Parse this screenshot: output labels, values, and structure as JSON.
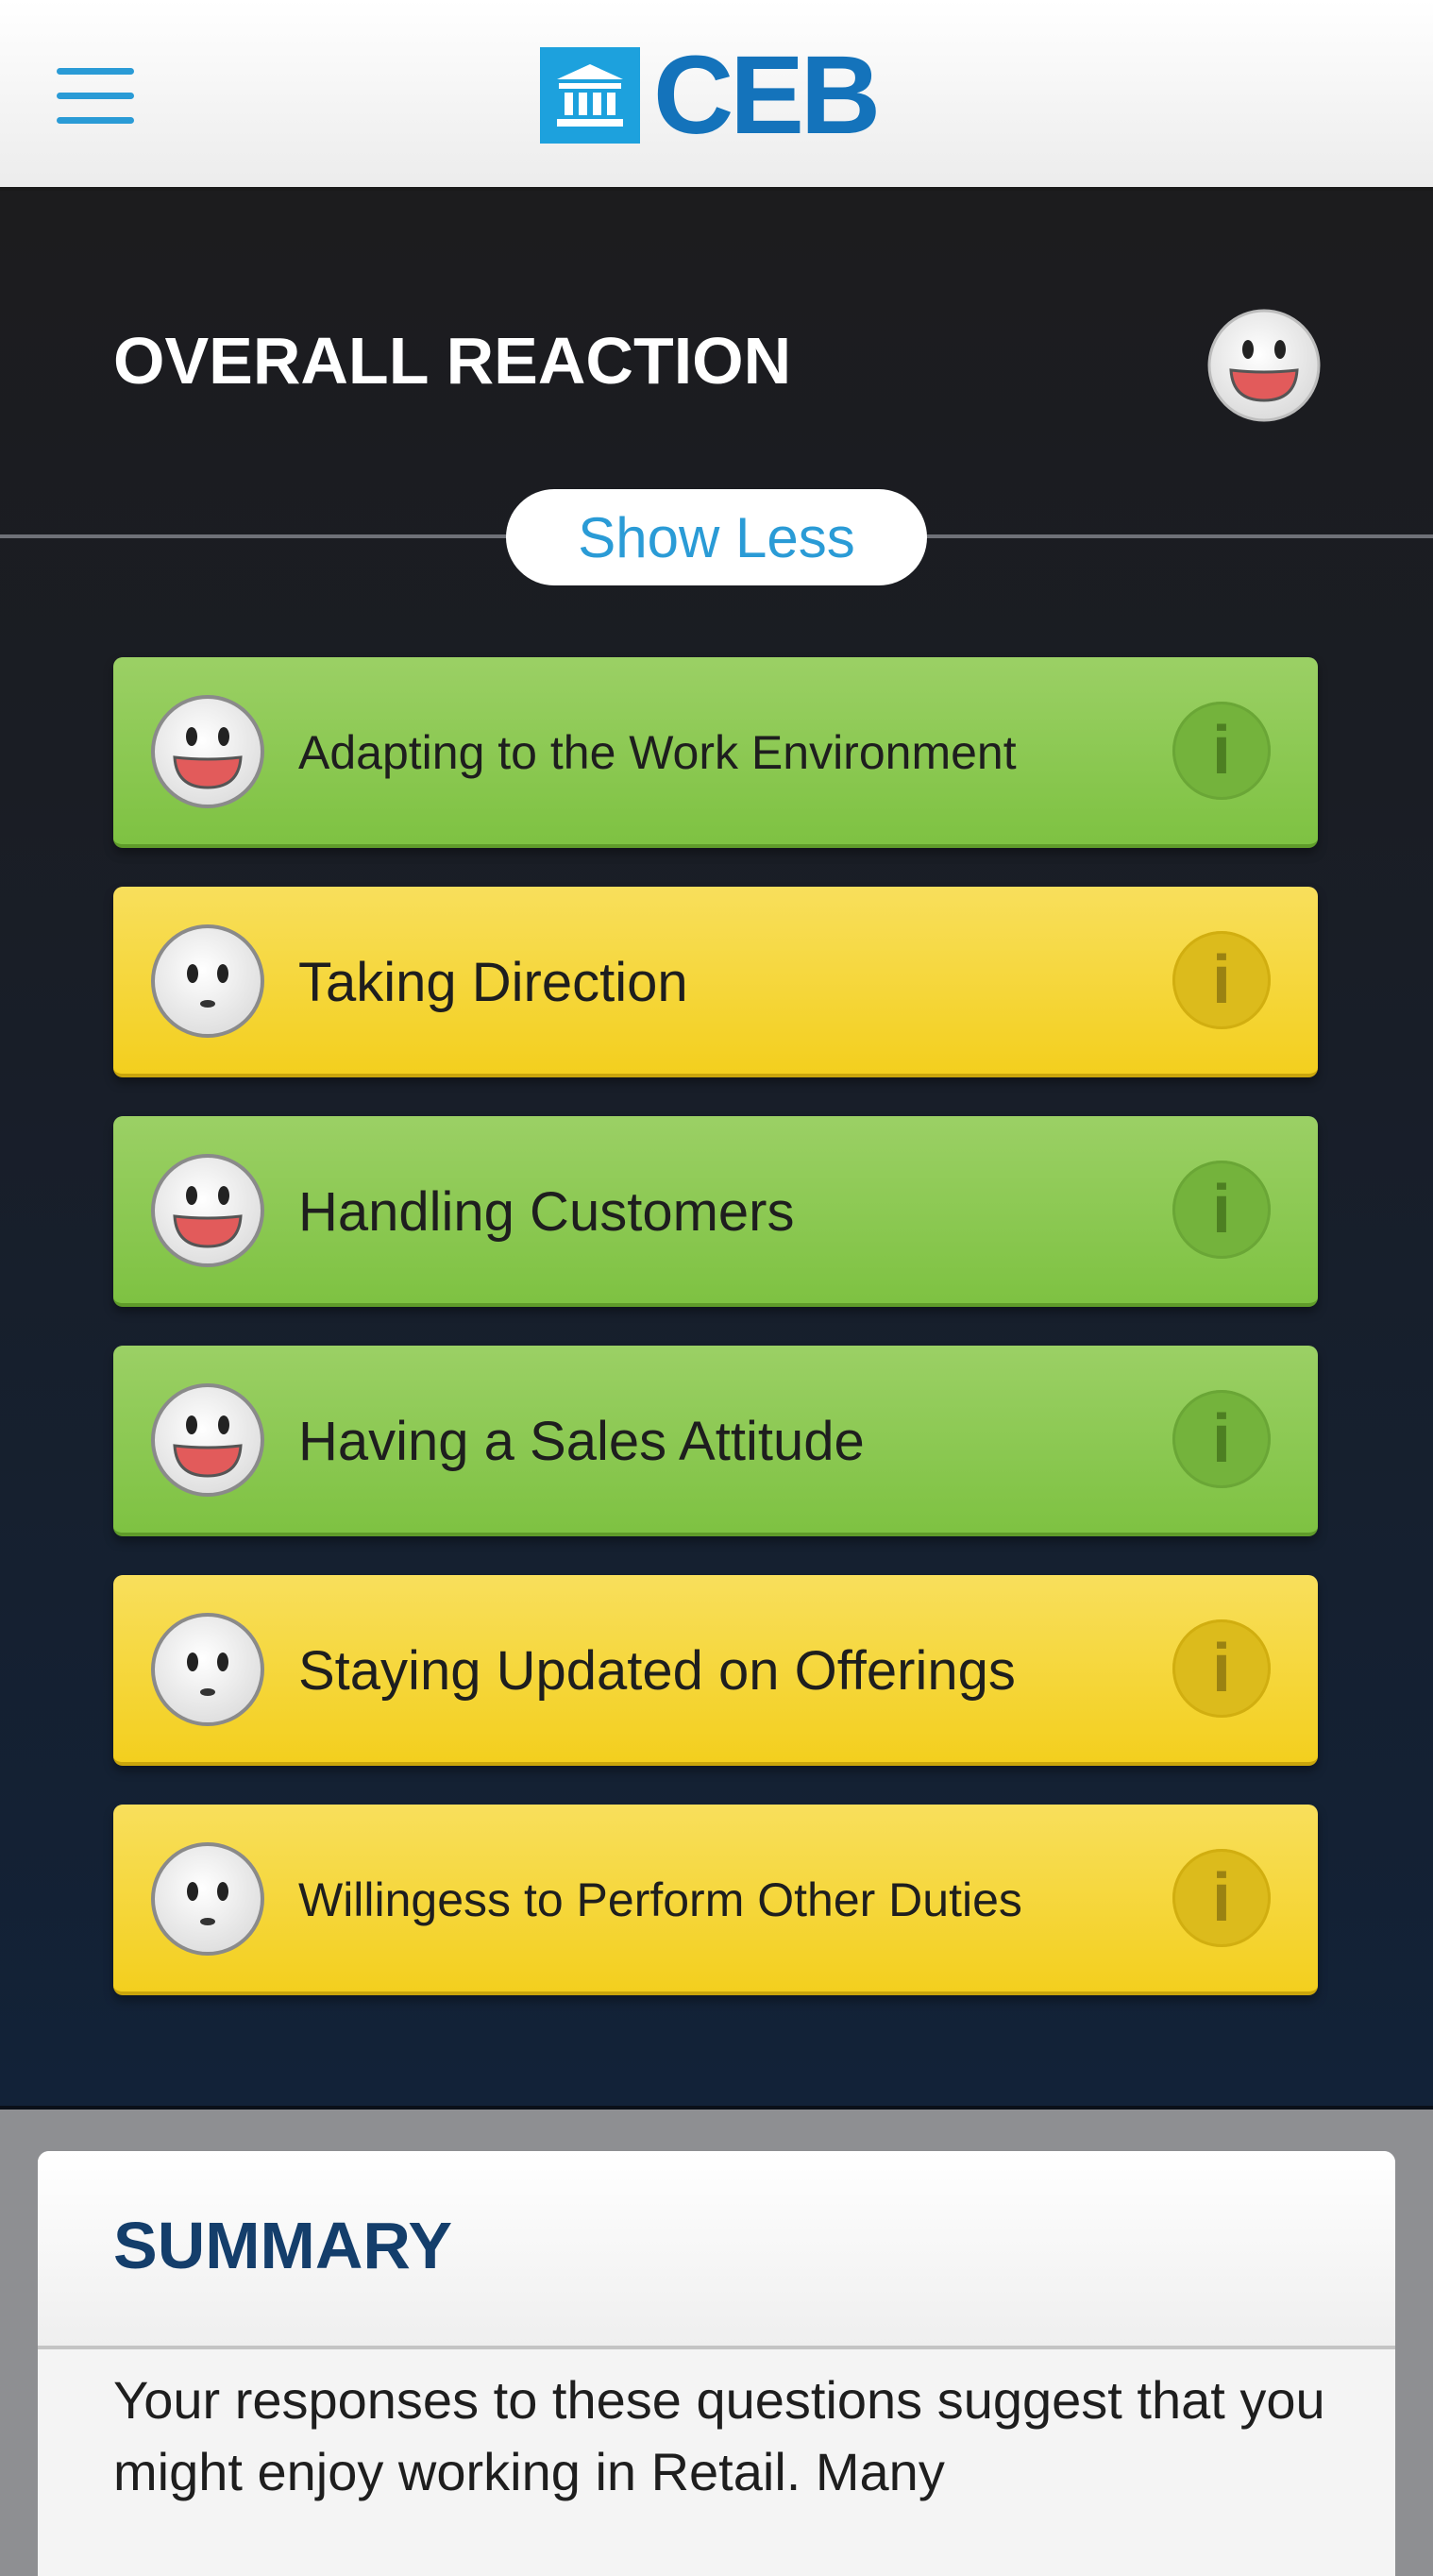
{
  "header": {
    "menu_icon": "hamburger-icon",
    "logo_text": "CEB",
    "logo_icon": "bank-building-icon",
    "accent_color": "#2a9bd6",
    "logo_color": "#1473bb"
  },
  "overall": {
    "title": "OVERALL REACTION",
    "reaction": "happy",
    "toggle_label": "Show Less"
  },
  "reactions": [
    {
      "label": "Adapting to the Work Environment",
      "reaction": "happy",
      "color": "#8cc84f"
    },
    {
      "label": "Taking Direction",
      "reaction": "neutral",
      "color": "#f6d738"
    },
    {
      "label": "Handling Customers",
      "reaction": "happy",
      "color": "#8cc84f"
    },
    {
      "label": "Having a Sales Attitude",
      "reaction": "happy",
      "color": "#8cc84f"
    },
    {
      "label": "Staying Updated on Offerings",
      "reaction": "neutral",
      "color": "#f6d738"
    },
    {
      "label": "Willingess to Perform Other Duties",
      "reaction": "neutral",
      "color": "#f6d738"
    }
  ],
  "info_icon": "info-icon",
  "info_glyph": "i",
  "summary": {
    "title": "SUMMARY",
    "text": "Your responses to these questions suggest that you might enjoy working in Retail. Many"
  }
}
